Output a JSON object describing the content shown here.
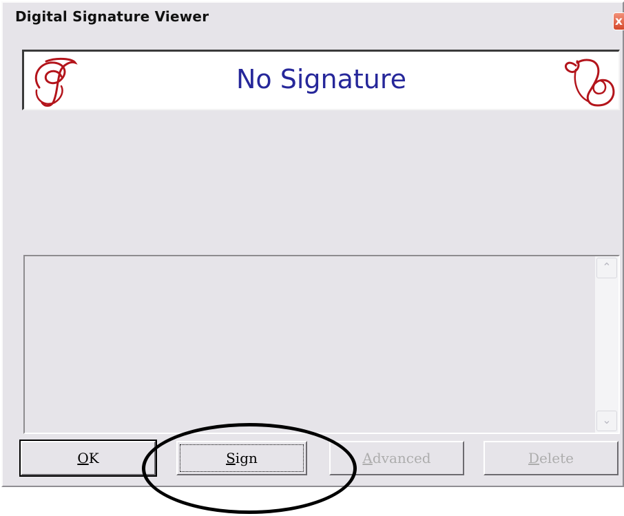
{
  "window": {
    "title": "Digital Signature Viewer",
    "close_label": "x"
  },
  "banner": {
    "status_text": "No Signature",
    "ornament_color": "#b3141b",
    "text_color": "#26279a"
  },
  "details": {
    "scroll_up_glyph": "⌃",
    "scroll_down_glyph": "⌄"
  },
  "buttons": {
    "ok": {
      "prefix": "",
      "underlined": "O",
      "suffix": "K",
      "enabled": true
    },
    "sign": {
      "prefix": "",
      "underlined": "S",
      "suffix": "ign",
      "enabled": true
    },
    "advanced": {
      "prefix": "",
      "underlined": "A",
      "suffix": "dvanced",
      "enabled": false
    },
    "delete": {
      "prefix": "",
      "underlined": "D",
      "suffix": "elete",
      "enabled": false
    }
  },
  "annotation": {
    "highlight_target": "sign-button"
  }
}
